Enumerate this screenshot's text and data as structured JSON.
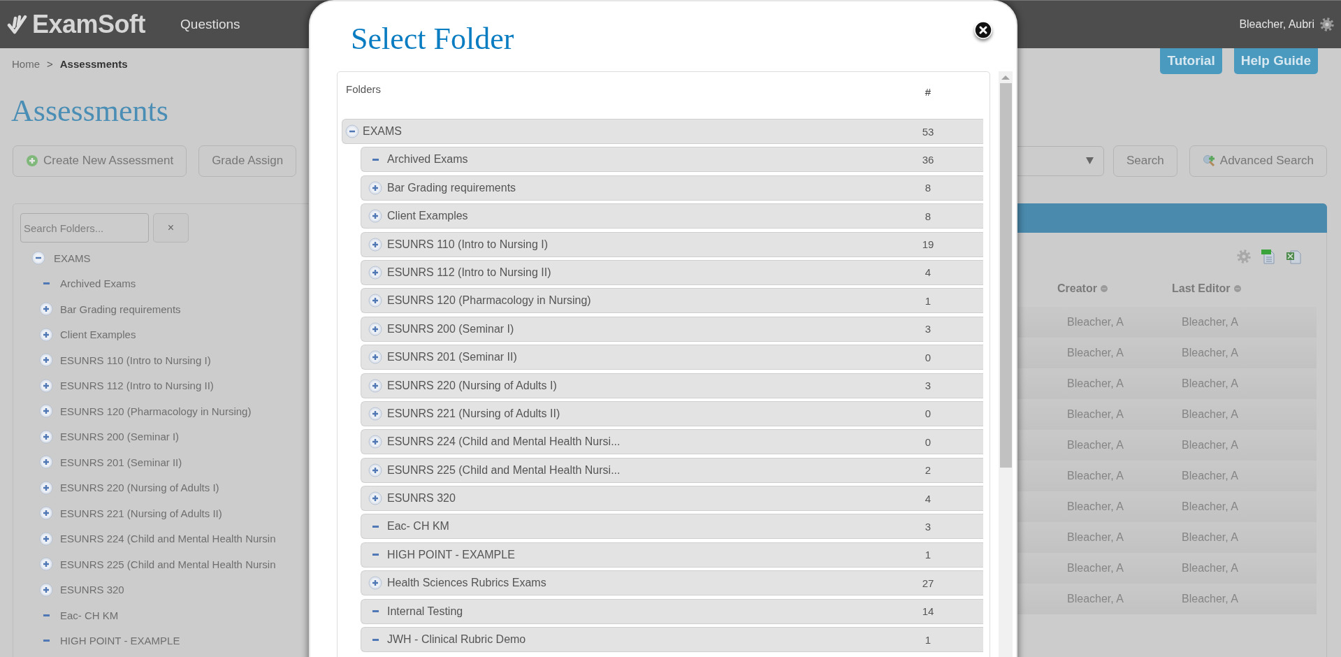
{
  "header": {
    "logo": "ExamSoft",
    "nav": [
      "Questions"
    ],
    "user": "Bleacher, Aubri"
  },
  "breadcrumb": {
    "items": [
      "Home",
      "Assessments"
    ],
    "separator": ">"
  },
  "help_buttons": [
    "Tutorial",
    "Help Guide"
  ],
  "page_title": "Assessments",
  "toolbar": {
    "left_buttons": [
      {
        "label": "Create New Assessment",
        "kind": "create"
      },
      {
        "label": "Grade Assign",
        "kind": "plain"
      }
    ],
    "right_buttons": [
      {
        "label": "Search",
        "kind": "plain"
      },
      {
        "label": "Advanced Search",
        "kind": "advanced"
      }
    ]
  },
  "folder_panel": {
    "search": {
      "placeholder": "Search Folders..."
    },
    "clear_button": "×",
    "tree": [
      {
        "label": "EXAMS",
        "kind": "branch",
        "expanded": true,
        "children": [
          {
            "label": "Archived Exams",
            "kind": "leaf"
          },
          {
            "label": "Bar Grading requirements",
            "kind": "branch",
            "expanded": false
          },
          {
            "label": "Client Examples",
            "kind": "branch",
            "expanded": false
          },
          {
            "label": "ESUNRS 110 (Intro to Nursing I)",
            "kind": "branch",
            "expanded": false
          },
          {
            "label": "ESUNRS 112 (Intro to Nursing II)",
            "kind": "branch",
            "expanded": false
          },
          {
            "label": "ESUNRS 120 (Pharmacology in Nursing)",
            "kind": "branch",
            "expanded": false
          },
          {
            "label": "ESUNRS 200 (Seminar I)",
            "kind": "branch",
            "expanded": false
          },
          {
            "label": "ESUNRS 201 (Seminar II)",
            "kind": "branch",
            "expanded": false
          },
          {
            "label": "ESUNRS 220 (Nursing of Adults I)",
            "kind": "branch",
            "expanded": false
          },
          {
            "label": "ESUNRS 221 (Nursing of Adults II)",
            "kind": "branch",
            "expanded": false
          },
          {
            "label": "ESUNRS 224 (Child and Mental Health Nursin",
            "kind": "branch",
            "expanded": false
          },
          {
            "label": "ESUNRS 225 (Child and Mental Health Nursin",
            "kind": "branch",
            "expanded": false
          },
          {
            "label": "ESUNRS 320",
            "kind": "branch",
            "expanded": false
          },
          {
            "label": "Eac- CH KM",
            "kind": "leaf"
          },
          {
            "label": "HIGH POINT - EXAMPLE",
            "kind": "leaf"
          }
        ]
      }
    ]
  },
  "results": {
    "columns": [
      "Creator",
      "Last Editor"
    ],
    "rows": [
      [
        "Bleacher, A",
        "Bleacher, A"
      ],
      [
        "Bleacher, A",
        "Bleacher, A"
      ],
      [
        "Bleacher, A",
        "Bleacher, A"
      ],
      [
        "Bleacher, A",
        "Bleacher, A"
      ],
      [
        "Bleacher, A",
        "Bleacher, A"
      ],
      [
        "Bleacher, A",
        "Bleacher, A"
      ],
      [
        "Bleacher, A",
        "Bleacher, A"
      ],
      [
        "Bleacher, A",
        "Bleacher, A"
      ],
      [
        "Bleacher, A",
        "Bleacher, A"
      ],
      [
        "Bleacher, A",
        "Bleacher, A"
      ]
    ]
  },
  "dialog": {
    "title": "Select Folder",
    "columns": [
      "Folders",
      "#"
    ],
    "tree": [
      {
        "label": "EXAMS",
        "count": "53",
        "kind": "branch",
        "expanded": true,
        "children": [
          {
            "label": "Archived Exams",
            "count": "36",
            "kind": "leaf"
          },
          {
            "label": "Bar Grading requirements",
            "count": "8",
            "kind": "branch",
            "expanded": false
          },
          {
            "label": "Client Examples",
            "count": "8",
            "kind": "branch",
            "expanded": false
          },
          {
            "label": "ESUNRS 110 (Intro to Nursing I)",
            "count": "19",
            "kind": "branch",
            "expanded": false
          },
          {
            "label": "ESUNRS 112 (Intro to Nursing II)",
            "count": "4",
            "kind": "branch",
            "expanded": false
          },
          {
            "label": "ESUNRS 120 (Pharmacology in Nursing)",
            "count": "1",
            "kind": "branch",
            "expanded": false
          },
          {
            "label": "ESUNRS 200 (Seminar I)",
            "count": "3",
            "kind": "branch",
            "expanded": false
          },
          {
            "label": "ESUNRS 201 (Seminar II)",
            "count": "0",
            "kind": "branch",
            "expanded": false
          },
          {
            "label": "ESUNRS 220 (Nursing of Adults I)",
            "count": "3",
            "kind": "branch",
            "expanded": false
          },
          {
            "label": "ESUNRS 221 (Nursing of Adults II)",
            "count": "0",
            "kind": "branch",
            "expanded": false
          },
          {
            "label": "ESUNRS 224 (Child and Mental Health Nursi...",
            "count": "0",
            "kind": "branch",
            "expanded": false
          },
          {
            "label": "ESUNRS 225 (Child and Mental Health Nursi...",
            "count": "2",
            "kind": "branch",
            "expanded": false
          },
          {
            "label": "ESUNRS 320",
            "count": "4",
            "kind": "branch",
            "expanded": false
          },
          {
            "label": "Eac- CH KM",
            "count": "3",
            "kind": "leaf"
          },
          {
            "label": "HIGH POINT - EXAMPLE",
            "count": "1",
            "kind": "leaf"
          },
          {
            "label": "Health Sciences Rubrics Exams",
            "count": "27",
            "kind": "branch",
            "expanded": false
          },
          {
            "label": "Internal Testing",
            "count": "14",
            "kind": "leaf"
          },
          {
            "label": "JWH - Clinical Rubric Demo",
            "count": "1",
            "kind": "leaf"
          }
        ]
      }
    ]
  }
}
